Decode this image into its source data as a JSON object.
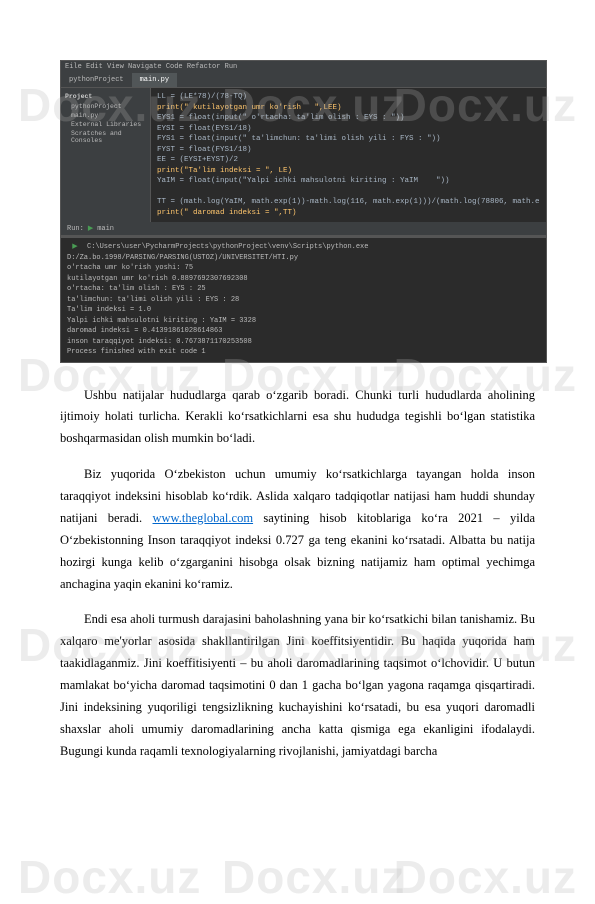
{
  "watermark": "Docx.uz",
  "ide": {
    "titlebar": "Eile  Edit  View  Navigate  Code  Refactor  Run",
    "project_label": "pythonProject",
    "tab_main": "main.py",
    "sidebar": {
      "title": "Project",
      "items": [
        "pythonProject",
        "main.py",
        "External Libraries",
        "Scratches and Consoles"
      ]
    },
    "code": [
      "LL = (LE*78)/(78-TQ)",
      "print(\" kutilayotgan umr ko'rish   \",LEE)",
      "EYS1 = float(input(\" o'rtacha: ta'lim olish : EYS : \"))",
      "EYSI = float(EYS1/18)",
      "FYS1 = float(input(\" ta'limchun: ta'limi olish yili : FYS : \"))",
      "FYST = float(FYS1/18)",
      "EE = (EYSI+EYST)/2",
      "print(\"Ta'lim indeksi = \", LE)",
      "YaIM = float(input(\"Yalpi ichki mahsulotni kiriting : YaIM    \"))",
      "",
      "TT = (math.log(YaIM, math.exp(1))-math.log(116, math.exp(1)))/(math.log(78806, math.e",
      "print(\" daromad indeksi = \",TT)"
    ],
    "run": {
      "label": "Run:",
      "name": "main"
    },
    "console": [
      "C:\\Users\\user\\PycharmProjects\\pythonProject\\venv\\Scripts\\python.exe D:/Za.bo.1998/PARSING/PARSING(USTOZ)/UNIVERSITET/HTI.py",
      "o'rtacha umr ko'rish yoshi: 75",
      "kutilayotgan umr ko'rish   0.8897692307692308",
      "o'rtacha: ta'lim olish : EYS : 25",
      "ta'limchun: ta'limi olish yili : EYS    : 28",
      "Ta'lim indeksi =  1.0",
      "Yalpi ichki mahsulotni kiriting : YaIM =  3328",
      "daromad indeksi =  0.41391861028614863",
      "inson taraqqiyot indeksi:  0.7673871170253508",
      "",
      "Process finished with exit code 1"
    ]
  },
  "paragraphs": {
    "p1": "Ushbu natijalar hududlarga qarab oʻzgarib boradi. Chunki turli hududlarda aholining ijtimoiy holati turlicha. Kerakli koʻrsatkichlarni esa shu hududga tegishli boʻlgan statistika boshqarmasidan olish mumkin boʻladi.",
    "p2_a": "Biz yuqorida Oʻzbekiston uchun umumiy koʻrsatkichlarga tayangan holda inson taraqqiyot indeksini hisoblab koʻrdik. Aslida xalqaro tadqiqotlar natijasi ham huddi shunday natijani beradi. ",
    "p2_link": "www.theglobal.com",
    "p2_b": " saytining hisob kitoblariga koʻra 2021 – yilda Oʻzbekistonning Inson taraqqiyot indeksi 0.727 ga teng ekanini koʻrsatadi. Albatta bu natija hozirgi kunga kelib oʻzgarganini hisobga olsak bizning natijamiz ham optimal yechimga anchagina yaqin ekanini koʻramiz.",
    "p3": "Endi esa aholi turmush darajasini baholashning yana bir koʻrsatkichi bilan tanishamiz. Bu xalqaro me'yorlar asosida shakllantirilgan Jini koeffitsiyentidir. Bu haqida yuqorida ham taakidlaganmiz. Jini koeffitisiyenti – bu aholi daromadlarining taqsimot oʻlchovidir. U butun mamlakat boʻyicha daromad taqsimotini 0 dan 1 gacha boʻlgan yagona raqamga qisqartiradi. Jini indeksining yuqoriligi tengsizlikning kuchayishini koʻrsatadi, bu esa yuqori daromadli shaxslar aholi umumiy daromadlarining ancha katta qismiga ega ekanligini ifodalaydi. Bugungi kunda raqamli texnologiyalarning rivojlanishi, jamiyatdagi barcha"
  }
}
